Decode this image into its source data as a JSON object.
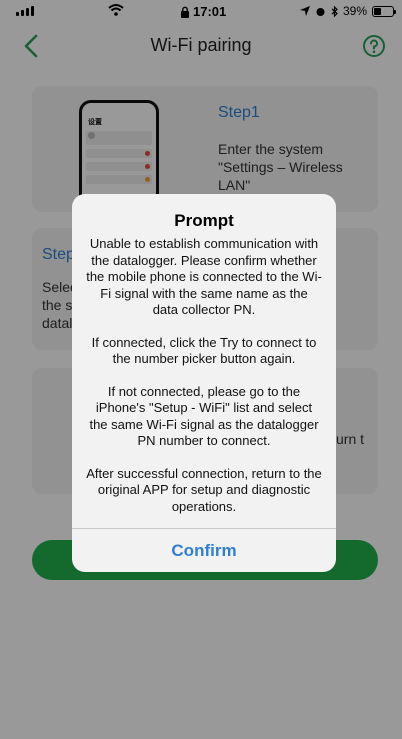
{
  "status_bar": {
    "time": "17:01",
    "battery": "39%",
    "battery_level": 0.39
  },
  "nav": {
    "title": "Wi-Fi pairing",
    "back_icon": "chevron-left-icon",
    "help_icon": "question-circle-icon",
    "accent": "#2aa15a"
  },
  "steps": [
    {
      "title": "Step1",
      "description": "Enter the system \"Settings – Wireless LAN\""
    },
    {
      "title": "Step",
      "description": "Selec the s datal"
    },
    {
      "title": "",
      "description": "urn t"
    }
  ],
  "phone_mock": {
    "heading": "设置"
  },
  "alert": {
    "title": "Prompt",
    "paragraphs": [
      "Unable to establish communication with the datalogger. Please confirm whether the mobile phone is connected to the Wi-Fi signal with the same name as the data collector PN.",
      "If connected, click the Try to connect to the number picker button again.",
      "If not connected, please go to the iPhone's \"Setup - WiFi\" list and select the same Wi-Fi signal as the datalogger PN number to connect.",
      "After successful connection, return to the original APP for setup and diagnostic operations."
    ],
    "confirm_label": "Confirm"
  },
  "colors": {
    "step_title": "#2f7fd6",
    "button_green": "#22b14c",
    "alert_button": "#2f7fd6"
  }
}
